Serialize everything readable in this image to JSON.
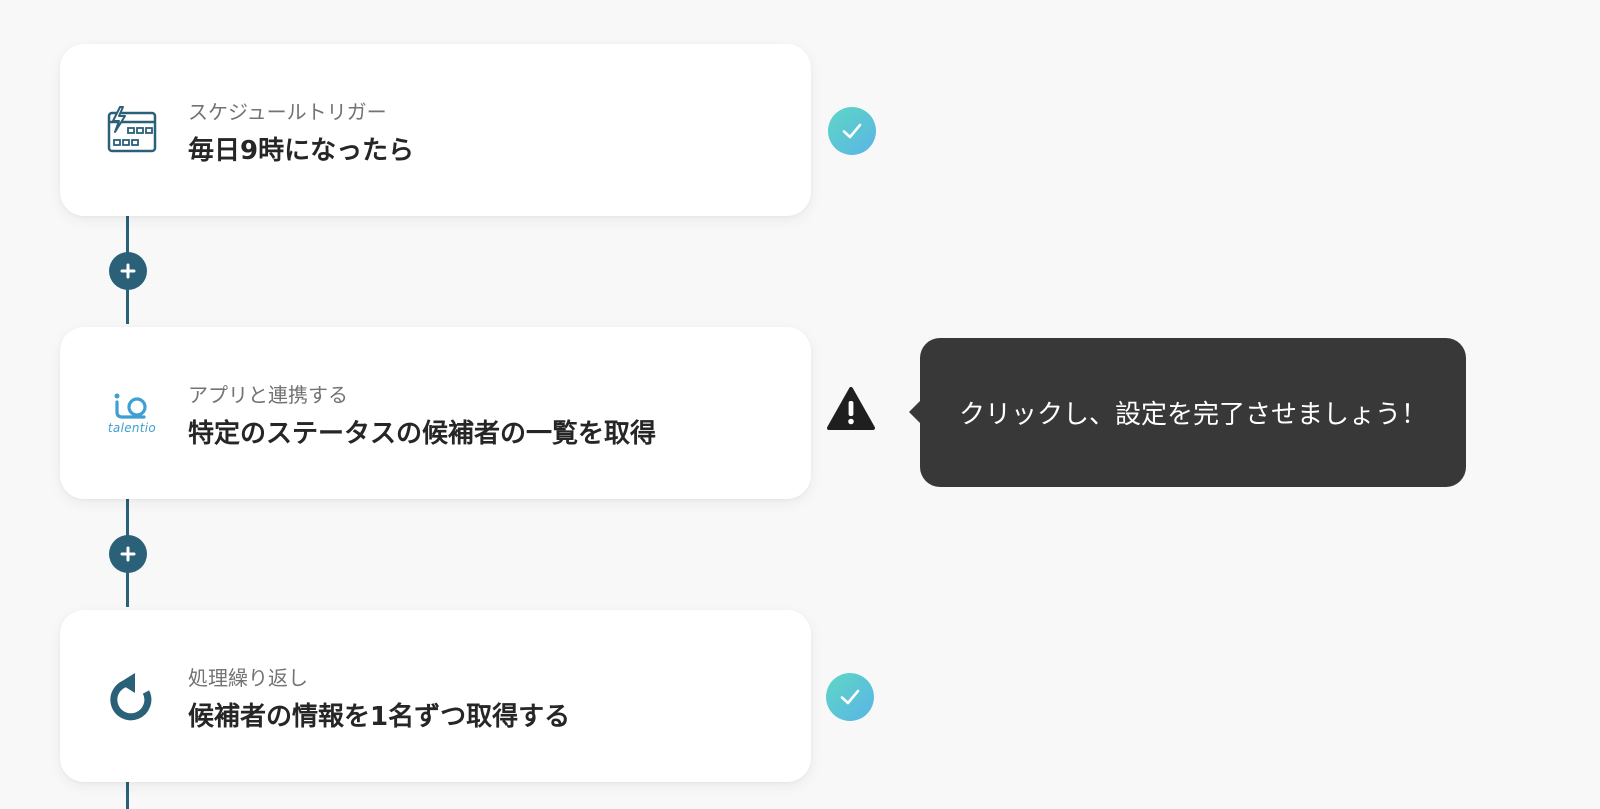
{
  "flow": {
    "steps": [
      {
        "subtitle": "スケジュールトリガー",
        "title": "毎日9時になったら",
        "icon": "schedule-trigger-icon",
        "status": "complete"
      },
      {
        "subtitle": "アプリと連携する",
        "title": "特定のステータスの候補者の一覧を取得",
        "icon": "talentio-logo",
        "logo_text": "talentio",
        "status": "warning"
      },
      {
        "subtitle": "処理繰り返し",
        "title": "候補者の情報を1名ずつ取得する",
        "icon": "loop-arrow-icon",
        "status": "complete"
      }
    ]
  },
  "tooltip": {
    "text": "クリックし、設定を完了させましょう！"
  },
  "colors": {
    "background": "#f8f8f8",
    "connector": "#2a6178",
    "check_gradient_start": "#5ed7c4",
    "check_gradient_end": "#5ab4e6",
    "tooltip_bg": "#383838",
    "talentio_blue": "#3e9fd2"
  }
}
